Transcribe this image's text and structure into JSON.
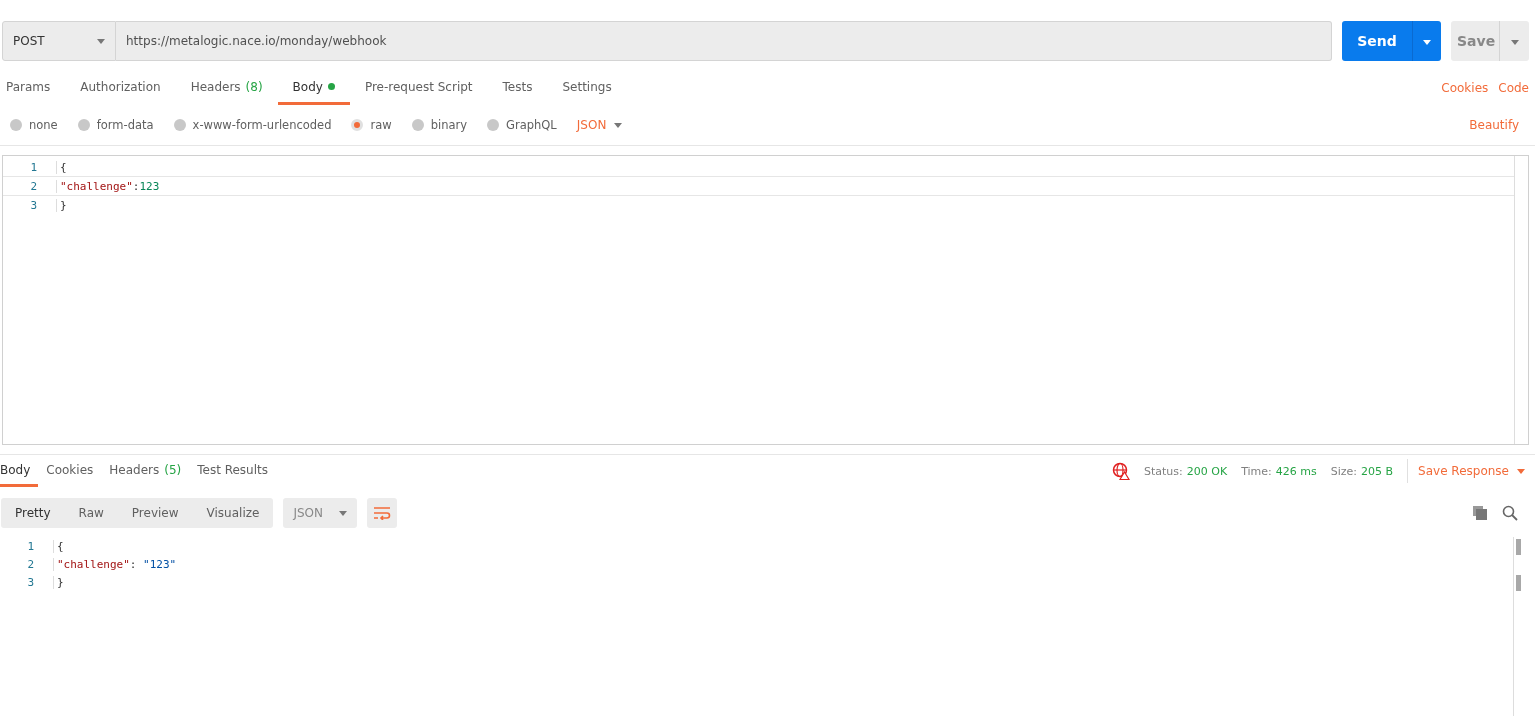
{
  "request": {
    "method": "POST",
    "url": "https://metalogic.nace.io/monday/webhook",
    "send": "Send",
    "save": "Save"
  },
  "request_tabs": [
    {
      "label": "Params",
      "dot": false,
      "selected": false
    },
    {
      "label": "Authorization",
      "dot": false,
      "selected": false
    },
    {
      "label": "Headers",
      "count": "(8)",
      "dot": false,
      "selected": false
    },
    {
      "label": "Body",
      "dot": true,
      "selected": true
    },
    {
      "label": "Pre-request Script",
      "dot": false,
      "selected": false
    },
    {
      "label": "Tests",
      "dot": false,
      "selected": false
    },
    {
      "label": "Settings",
      "dot": false,
      "selected": false
    }
  ],
  "links": [
    "Cookies",
    "Code"
  ],
  "body_types": [
    {
      "label": "none",
      "selected": false
    },
    {
      "label": "form-data",
      "selected": false
    },
    {
      "label": "x-www-form-urlencoded",
      "selected": false
    },
    {
      "label": "raw",
      "selected": true
    },
    {
      "label": "binary",
      "selected": false
    },
    {
      "label": "GraphQL",
      "selected": false
    }
  ],
  "body_format": "JSON",
  "beautify": "Beautify",
  "request_body": [
    {
      "number": "1",
      "tokens": [
        {
          "kind": "punct",
          "text": "{"
        }
      ]
    },
    {
      "number": "2",
      "tokens": [
        {
          "kind": "key",
          "text": "\"challenge\""
        },
        {
          "kind": "punct",
          "text": ":"
        },
        {
          "kind": "number",
          "text": "123"
        }
      ]
    },
    {
      "number": "3",
      "tokens": [
        {
          "kind": "punct",
          "text": "}"
        }
      ]
    }
  ],
  "response_tabs": [
    {
      "label": "Body",
      "selected": true
    },
    {
      "label": "Cookies",
      "selected": false
    },
    {
      "label": "Headers",
      "count": "(5)",
      "selected": false
    },
    {
      "label": "Test Results",
      "selected": false
    }
  ],
  "stats": [
    {
      "label": "Status:",
      "value": "200 OK"
    },
    {
      "label": "Time:",
      "value": "426 ms"
    },
    {
      "label": "Size:",
      "value": "205 B"
    }
  ],
  "save_response": "Save Response",
  "view_modes": [
    {
      "label": "Pretty",
      "selected": true
    },
    {
      "label": "Raw",
      "selected": false
    },
    {
      "label": "Preview",
      "selected": false
    },
    {
      "label": "Visualize",
      "selected": false
    }
  ],
  "response_format": "JSON",
  "response_body": [
    {
      "number": "1",
      "tokens": [
        {
          "kind": "punct",
          "text": "{"
        }
      ]
    },
    {
      "number": "2",
      "tokens": [
        {
          "kind": "key",
          "text": "\"challenge\""
        },
        {
          "kind": "punct",
          "text": ": "
        },
        {
          "kind": "string",
          "text": "\"123\""
        }
      ]
    },
    {
      "number": "3",
      "tokens": [
        {
          "kind": "punct",
          "text": "}"
        }
      ]
    }
  ]
}
